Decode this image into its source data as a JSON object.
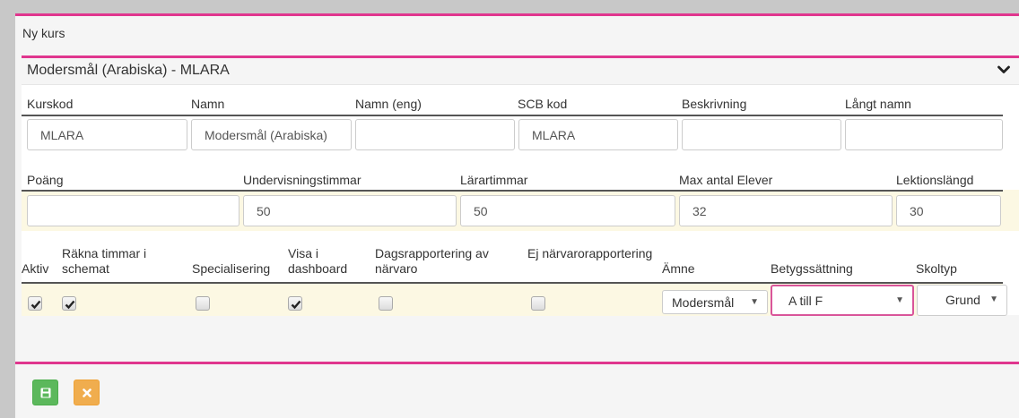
{
  "page": {
    "title": "Ny kurs"
  },
  "course": {
    "header": "Modersmål (Arabiska) - MLARA",
    "row1_labels": {
      "kurskod": "Kurskod",
      "namn": "Namn",
      "namn_eng": "Namn (eng)",
      "scb_kod": "SCB kod",
      "beskrivning": "Beskrivning",
      "langt_namn": "Långt namn"
    },
    "row1_values": {
      "kurskod": "MLARA",
      "namn": "Modersmål (Arabiska)",
      "namn_eng": "",
      "scb_kod": "MLARA",
      "beskrivning": "",
      "langt_namn": ""
    },
    "row2_labels": {
      "poang": "Poäng",
      "undervisningstimmar": "Undervisningstimmar",
      "lärartimmar": "Lärartimmar",
      "max_elever": "Max antal Elever",
      "lektionslangd": "Lektionslängd"
    },
    "row2_values": {
      "poang": "",
      "undervisningstimmar": "50",
      "lärartimmar": "50",
      "max_elever": "32",
      "lektionslangd": "30"
    },
    "row3_labels": {
      "aktiv": "Aktiv",
      "rakna_timmar": "Räkna timmar i schemat",
      "specialisering": "Specialisering",
      "visa_dashboard": "Visa i dashboard",
      "dagsrapportering": "Dagsrapportering av närvaro",
      "ej_narvaro": "Ej närvarorapportering",
      "amne": "Ämne",
      "betygssattning": "Betygssättning",
      "skoltyp": "Skoltyp"
    },
    "row3_values": {
      "aktiv": true,
      "rakna_timmar": true,
      "specialisering": false,
      "visa_dashboard": true,
      "dagsrapportering": false,
      "ej_narvaro": false,
      "amne": "Modersmål",
      "betygssattning": "A till F",
      "skoltyp": "Grund"
    }
  },
  "icons": {
    "chevron": "chevron-down-icon",
    "save": "floppy-disk-icon",
    "cancel": "close-icon"
  },
  "colors": {
    "accent": "#e0368e",
    "save_button": "#5cb85c",
    "cancel_button": "#f0ad4e",
    "highlight_band": "#fcf8e3"
  }
}
